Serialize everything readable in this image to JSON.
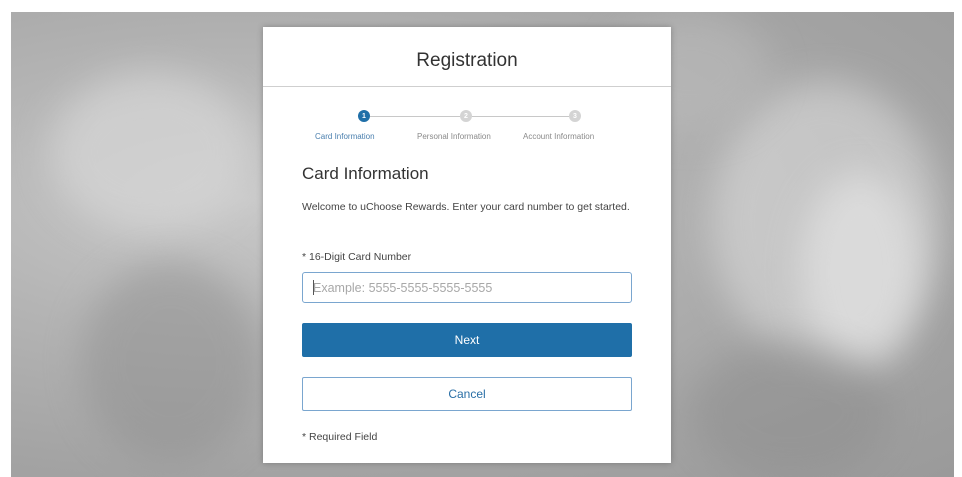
{
  "page": {
    "title": "Registration"
  },
  "stepper": {
    "steps": [
      {
        "number": "1",
        "label": "Card Information",
        "active": true
      },
      {
        "number": "2",
        "label": "Personal Information",
        "active": false
      },
      {
        "number": "3",
        "label": "Account Information",
        "active": false
      }
    ]
  },
  "form": {
    "section_title": "Card Information",
    "description": "Welcome to uChoose Rewards. Enter your card number to get started.",
    "card_number_label": "* 16-Digit Card Number",
    "card_number_placeholder": "Example: 5555-5555-5555-5555",
    "card_number_value": "",
    "next_label": "Next",
    "cancel_label": "Cancel",
    "required_note": "* Required Field"
  },
  "colors": {
    "accent": "#1f6fa8",
    "inactive_step": "#d4d4d4",
    "input_border": "#7aa6cf"
  }
}
